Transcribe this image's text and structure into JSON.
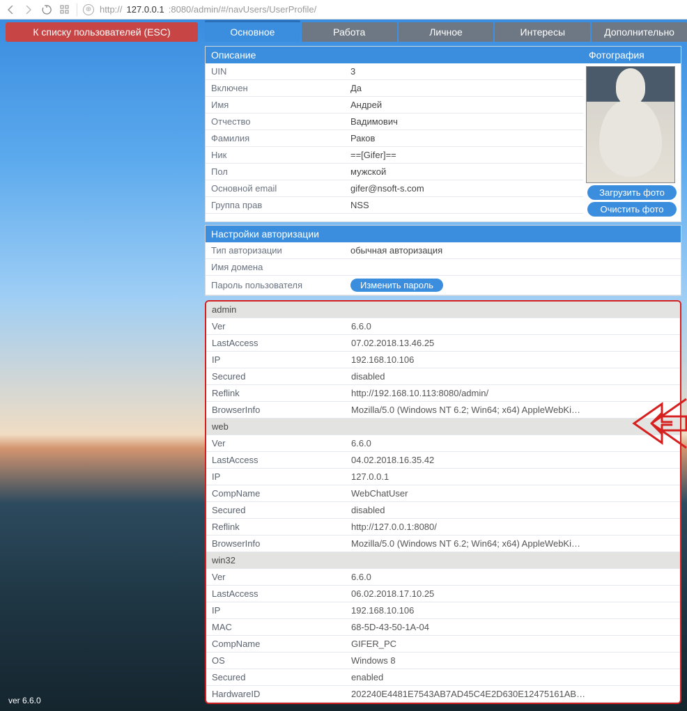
{
  "browser": {
    "url_prefix": "http://",
    "url_host": "127.0.0.1",
    "url_rest": ":8080/admin/#/navUsers/UserProfile/"
  },
  "back_button": "К списку пользователей (ESC)",
  "tabs": {
    "main": "Основное",
    "work": "Работа",
    "personal": "Личное",
    "interests": "Интересы",
    "extra": "Дополнительно"
  },
  "desc": {
    "header": "Описание",
    "rows": {
      "uin_k": "UIN",
      "uin_v": "3",
      "enabled_k": "Включен",
      "enabled_v": "Да",
      "name_k": "Имя",
      "name_v": "Андрей",
      "patronymic_k": "Отчество",
      "patronymic_v": "Вадимович",
      "surname_k": "Фамилия",
      "surname_v": "Раков",
      "nick_k": "Ник",
      "nick_v": "==[Gifer]==",
      "sex_k": "Пол",
      "sex_v": "мужской",
      "email_k": "Основной email",
      "email_v": "gifer@nsoft-s.com",
      "group_k": "Группа прав",
      "group_v": "NSS"
    }
  },
  "photo": {
    "header": "Фотография",
    "upload": "Загрузить фото",
    "clear": "Очистить фото"
  },
  "auth": {
    "header": "Настройки авторизации",
    "type_k": "Тип авторизации",
    "type_v": "обычная авторизация",
    "domain_k": "Имя домена",
    "domain_v": "",
    "pass_k": "Пароль пользователя",
    "pass_btn": "Изменить пароль"
  },
  "sessions": [
    {
      "group": "admin"
    },
    {
      "k": "Ver",
      "v": "6.6.0"
    },
    {
      "k": "LastAccess",
      "v": "07.02.2018.13.46.25"
    },
    {
      "k": "IP",
      "v": "192.168.10.106"
    },
    {
      "k": "Secured",
      "v": "disabled"
    },
    {
      "k": "Reflink",
      "v": "http://192.168.10.113:8080/admin/"
    },
    {
      "k": "BrowserInfo",
      "v": "Mozilla/5.0 (Windows NT 6.2; Win64; x64) AppleWebKi…"
    },
    {
      "group": "web"
    },
    {
      "k": "Ver",
      "v": "6.6.0"
    },
    {
      "k": "LastAccess",
      "v": "04.02.2018.16.35.42"
    },
    {
      "k": "IP",
      "v": "127.0.0.1"
    },
    {
      "k": "CompName",
      "v": "WebChatUser"
    },
    {
      "k": "Secured",
      "v": "disabled"
    },
    {
      "k": "Reflink",
      "v": "http://127.0.0.1:8080/"
    },
    {
      "k": "BrowserInfo",
      "v": "Mozilla/5.0 (Windows NT 6.2; Win64; x64) AppleWebKi…"
    },
    {
      "group": "win32"
    },
    {
      "k": "Ver",
      "v": "6.6.0"
    },
    {
      "k": "LastAccess",
      "v": "06.02.2018.17.10.25"
    },
    {
      "k": "IP",
      "v": "192.168.10.106"
    },
    {
      "k": "MAC",
      "v": "68-5D-43-50-1A-04"
    },
    {
      "k": "CompName",
      "v": "GIFER_PC"
    },
    {
      "k": "OS",
      "v": "Windows 8"
    },
    {
      "k": "Secured",
      "v": "enabled"
    },
    {
      "k": "HardwareID",
      "v": "202240E4481E7543AB7AD45C4E2D630E12475161AB…"
    }
  ],
  "version": "ver 6.6.0"
}
